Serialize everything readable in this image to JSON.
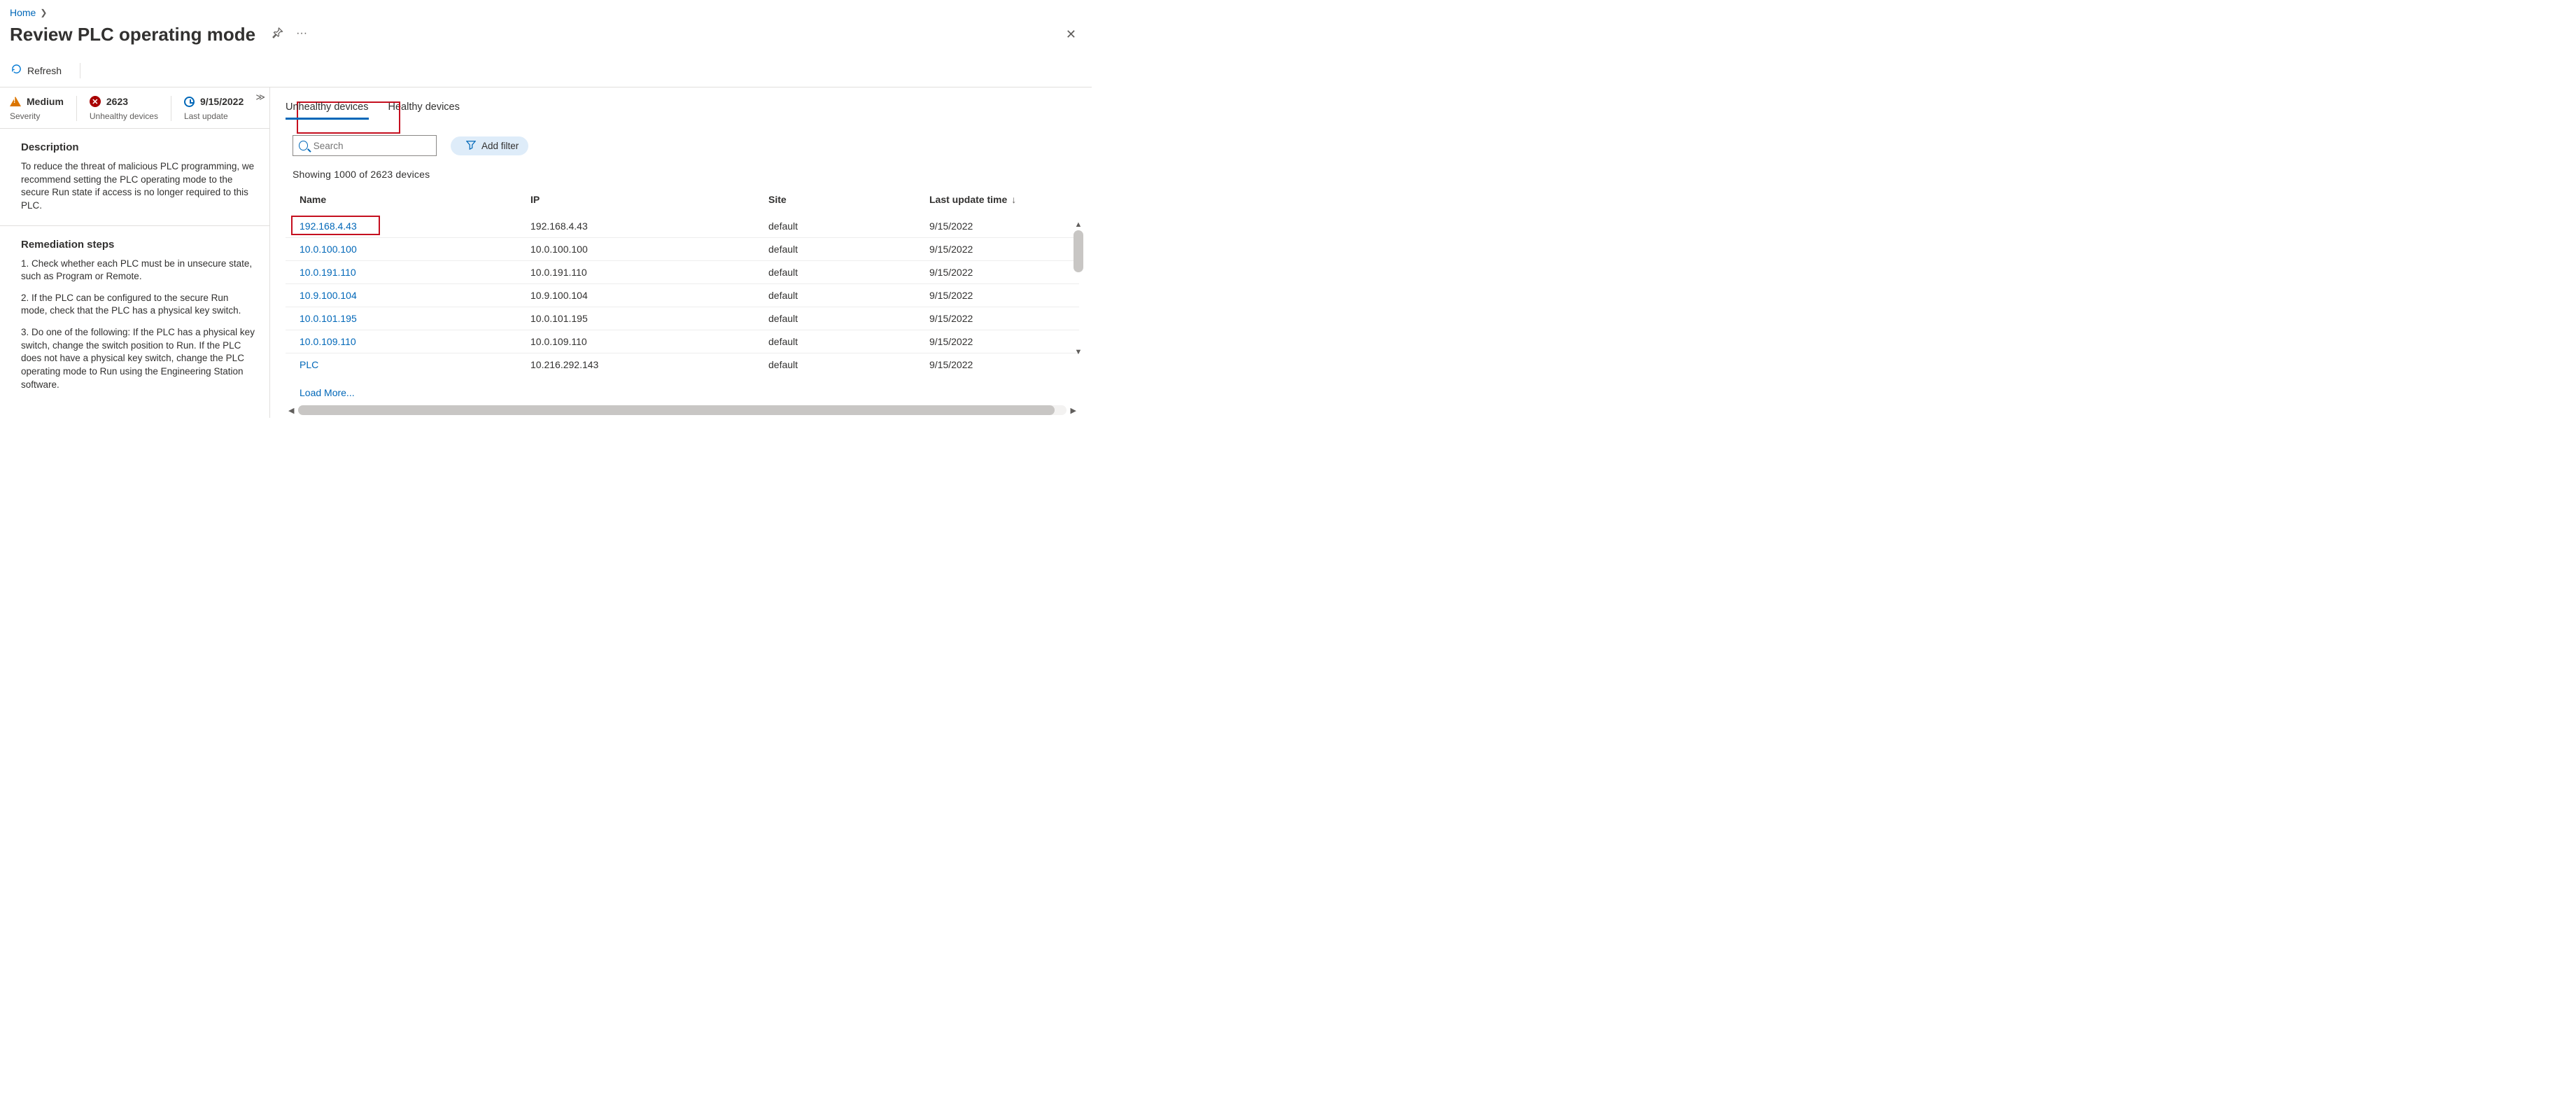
{
  "breadcrumb": {
    "home": "Home"
  },
  "header": {
    "title": "Review PLC operating mode"
  },
  "toolbar": {
    "refresh": "Refresh"
  },
  "stats": {
    "severity_label": "Severity",
    "severity_value": "Medium",
    "unhealthy_label": "Unhealthy devices",
    "unhealthy_value": "2623",
    "last_update_label": "Last update",
    "last_update_value": "9/15/2022"
  },
  "description": {
    "heading": "Description",
    "body": "To reduce the threat of malicious PLC programming, we recommend setting the PLC operating mode to the secure Run state if access is no longer required to this PLC."
  },
  "remediation": {
    "heading": "Remediation steps",
    "step1": "1. Check whether each PLC must be in unsecure state, such as Program or Remote.",
    "step2": "2. If the PLC can be configured to the secure Run mode, check that the PLC has a physical key switch.",
    "step3": "3. Do one of the following: If the PLC has a physical key switch, change the switch position to Run. If the PLC does not have a physical key switch, change the PLC operating mode to Run using the Engineering Station software."
  },
  "tabs": {
    "unhealthy": "Unhealthy devices",
    "healthy": "Healthy devices"
  },
  "search": {
    "placeholder": "Search"
  },
  "add_filter": "Add filter",
  "showing": "Showing 1000 of 2623 devices",
  "columns": {
    "name": "Name",
    "ip": "IP",
    "site": "Site",
    "last_update": "Last update time"
  },
  "rows": [
    {
      "name": "192.168.4.43",
      "ip": "192.168.4.43",
      "site": "default",
      "last_update": "9/15/2022"
    },
    {
      "name": "10.0.100.100",
      "ip": "10.0.100.100",
      "site": "default",
      "last_update": "9/15/2022"
    },
    {
      "name": "10.0.191.110",
      "ip": "10.0.191.110",
      "site": "default",
      "last_update": "9/15/2022"
    },
    {
      "name": "10.9.100.104",
      "ip": "10.9.100.104",
      "site": "default",
      "last_update": "9/15/2022"
    },
    {
      "name": "10.0.101.195",
      "ip": "10.0.101.195",
      "site": "default",
      "last_update": "9/15/2022"
    },
    {
      "name": "10.0.109.110",
      "ip": "10.0.109.110",
      "site": "default",
      "last_update": "9/15/2022"
    },
    {
      "name": "PLC",
      "ip": "10.216.292.143",
      "site": "default",
      "last_update": "9/15/2022"
    }
  ],
  "load_more": "Load More..."
}
